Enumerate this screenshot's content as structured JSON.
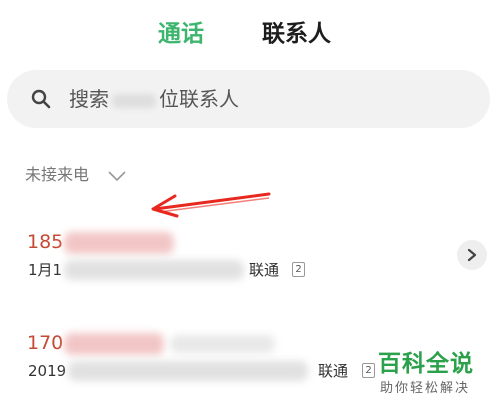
{
  "tabs": [
    {
      "label": "通话",
      "active": true
    },
    {
      "label": "联系人",
      "active": false
    }
  ],
  "colors": {
    "active_tab": "#3db56e",
    "missed_number": "#c64a33",
    "watermark": "#2aa14a"
  },
  "search": {
    "placeholder_prefix": "搜索",
    "placeholder_suffix": "位联系人"
  },
  "filter": {
    "label": "未接来电",
    "icon": "chevron-down-icon"
  },
  "calls": [
    {
      "number_prefix": "185",
      "date_prefix": "1月1",
      "carrier": "联通",
      "sim": "2"
    },
    {
      "number_prefix": "170",
      "date_prefix": "2019",
      "carrier": "联通",
      "sim": "2"
    }
  ],
  "watermark": {
    "title": "百科全说",
    "subtitle": "助你轻松解决"
  }
}
